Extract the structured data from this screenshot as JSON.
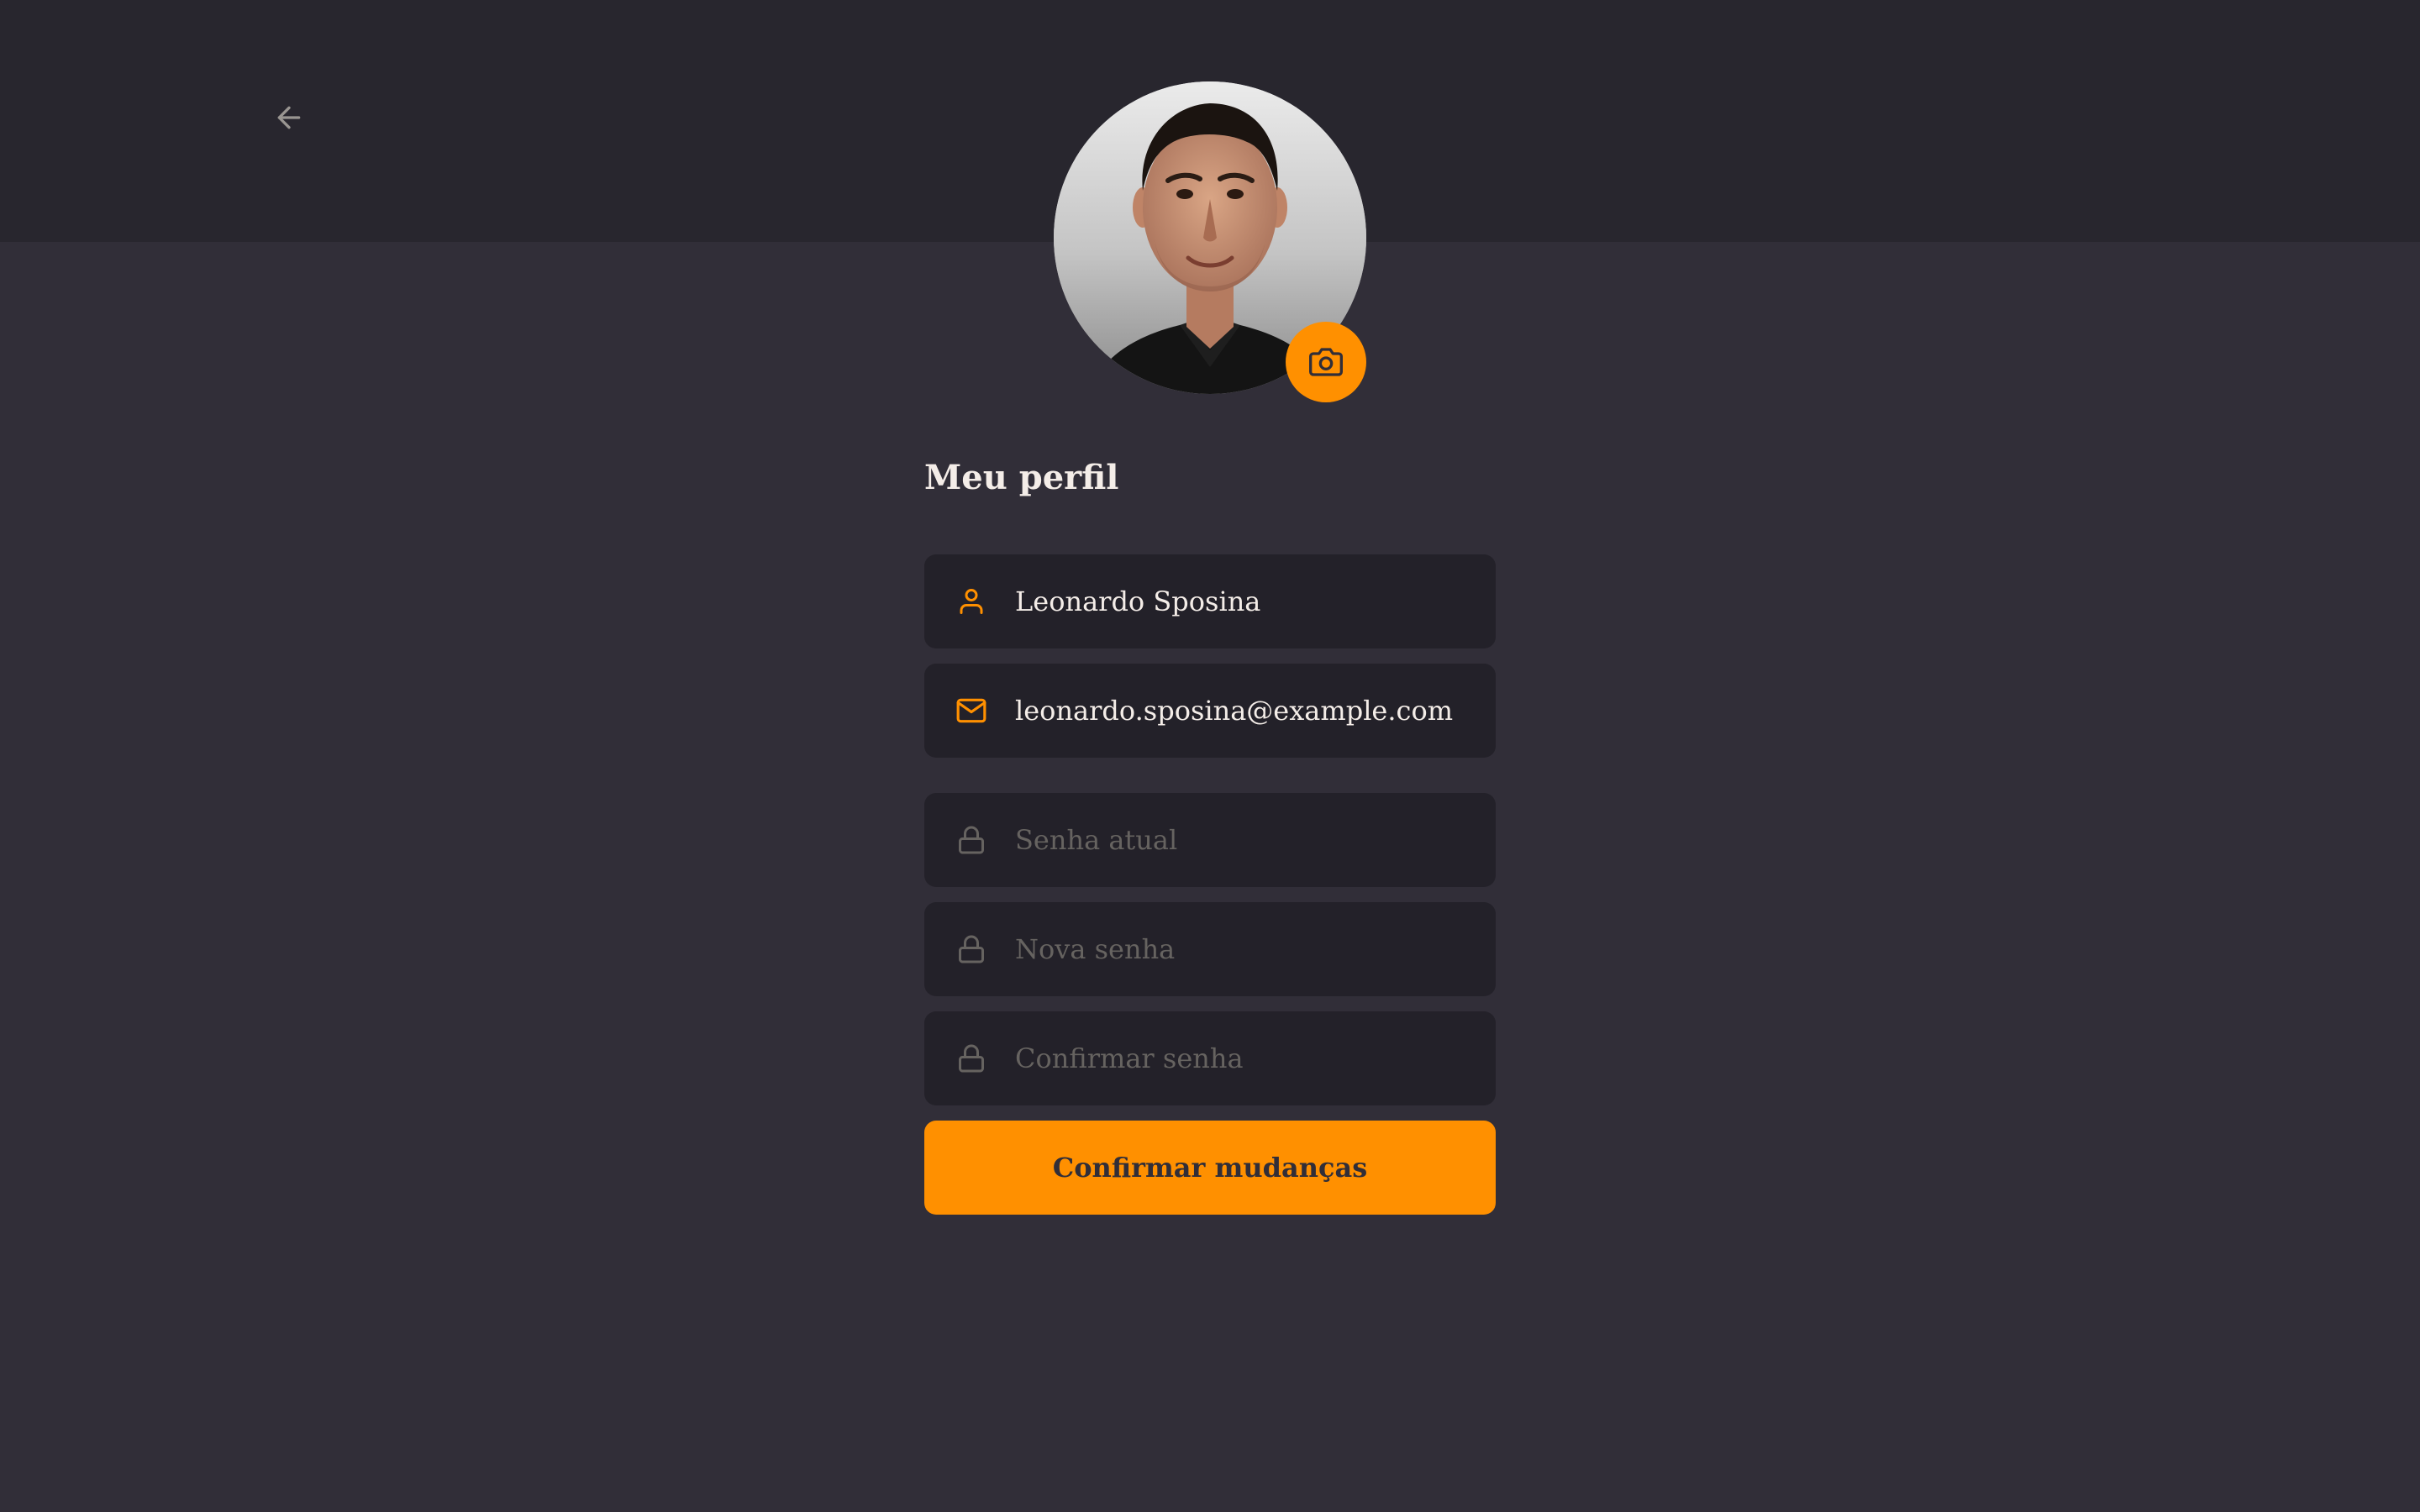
{
  "colors": {
    "background": "#312e38",
    "header": "#28262e",
    "field": "#232129",
    "accent": "#ff9000",
    "text": "#f4ede8",
    "placeholder": "#666360"
  },
  "header": {
    "back_icon": "arrow-left-icon"
  },
  "avatar": {
    "camera_icon": "camera-icon"
  },
  "profile": {
    "title": "Meu perfil",
    "name": {
      "icon": "user-icon",
      "value": "Leonardo Sposina"
    },
    "email": {
      "icon": "mail-icon",
      "value": "leonardo.sposina@example.com"
    },
    "old_password": {
      "icon": "lock-icon",
      "placeholder": "Senha atual"
    },
    "new_password": {
      "icon": "lock-icon",
      "placeholder": "Nova senha"
    },
    "confirm_password": {
      "icon": "lock-icon",
      "placeholder": "Confirmar senha"
    },
    "submit_label": "Confirmar mudanças"
  }
}
